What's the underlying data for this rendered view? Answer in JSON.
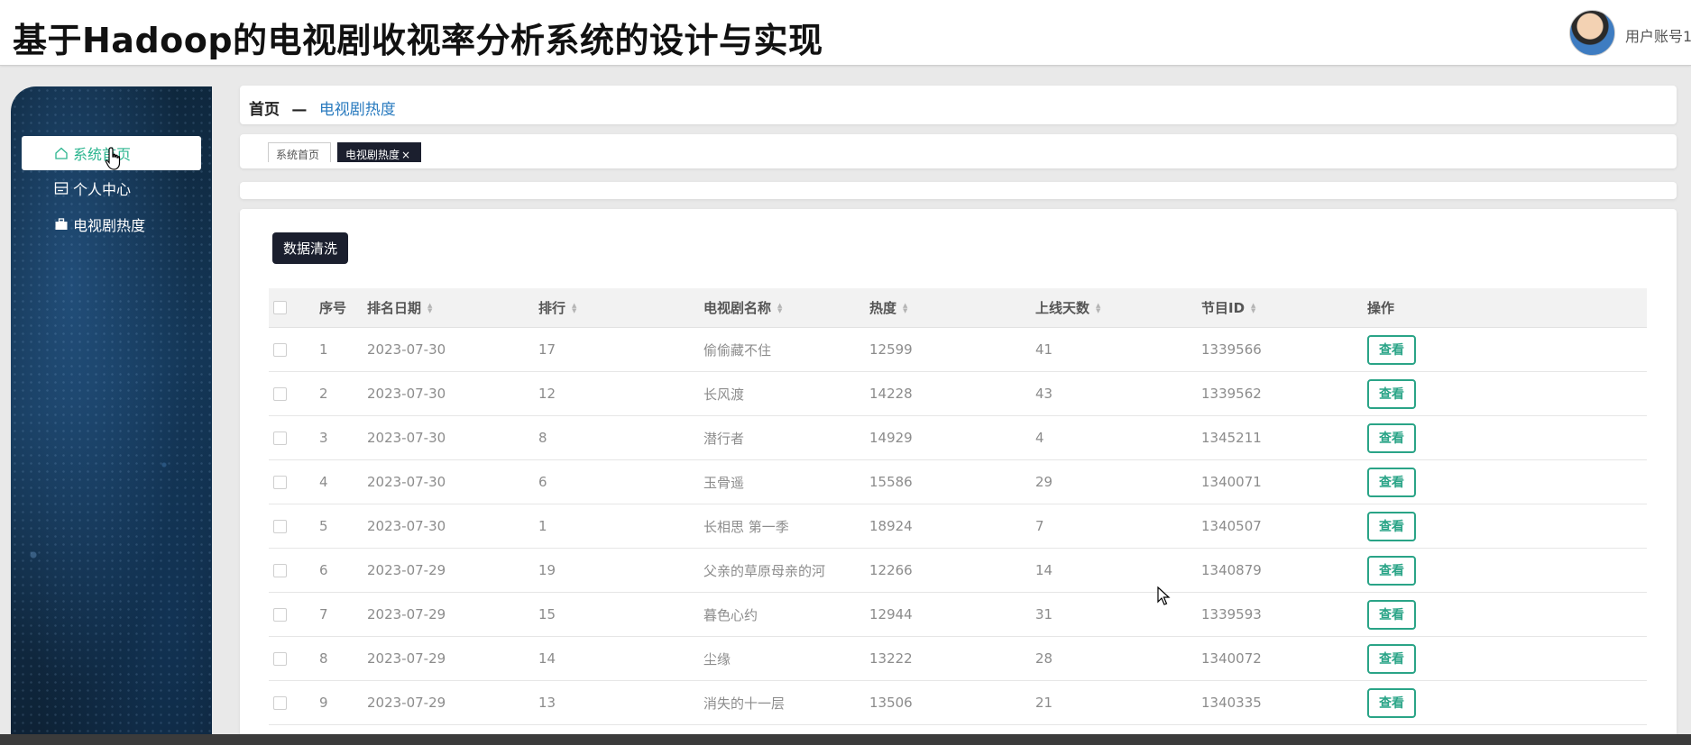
{
  "header": {
    "title": "基于Hadoop的电视剧收视率分析系统的设计与实现",
    "user_name": "用户账号1"
  },
  "sidebar": {
    "items": [
      {
        "label": "系统首页",
        "icon": "home-icon",
        "active": true
      },
      {
        "label": "个人中心",
        "icon": "profile-card-icon",
        "active": false
      },
      {
        "label": "电视剧热度",
        "icon": "briefcase-icon",
        "active": false
      }
    ]
  },
  "breadcrumb": {
    "home": "首页",
    "separator": "—",
    "current": "电视剧热度"
  },
  "tabs": {
    "home": "系统首页",
    "active": "电视剧热度",
    "close": "×"
  },
  "toolbar": {
    "clean_label": "数据清洗"
  },
  "table": {
    "headers": {
      "index": "序号",
      "date": "排名日期",
      "rank": "排行",
      "name": "电视剧名称",
      "heat": "热度",
      "days": "上线天数",
      "program_id": "节目ID",
      "action": "操作"
    },
    "view_label": "查看",
    "rows": [
      {
        "index": "1",
        "date": "2023-07-30",
        "rank": "17",
        "name": "偷偷藏不住",
        "heat": "12599",
        "days": "41",
        "program_id": "1339566"
      },
      {
        "index": "2",
        "date": "2023-07-30",
        "rank": "12",
        "name": "长风渡",
        "heat": "14228",
        "days": "43",
        "program_id": "1339562"
      },
      {
        "index": "3",
        "date": "2023-07-30",
        "rank": "8",
        "name": "潜行者",
        "heat": "14929",
        "days": "4",
        "program_id": "1345211"
      },
      {
        "index": "4",
        "date": "2023-07-30",
        "rank": "6",
        "name": "玉骨遥",
        "heat": "15586",
        "days": "29",
        "program_id": "1340071"
      },
      {
        "index": "5",
        "date": "2023-07-30",
        "rank": "1",
        "name": "长相思 第一季",
        "heat": "18924",
        "days": "7",
        "program_id": "1340507"
      },
      {
        "index": "6",
        "date": "2023-07-29",
        "rank": "19",
        "name": "父亲的草原母亲的河",
        "heat": "12266",
        "days": "14",
        "program_id": "1340879"
      },
      {
        "index": "7",
        "date": "2023-07-29",
        "rank": "15",
        "name": "暮色心约",
        "heat": "12944",
        "days": "31",
        "program_id": "1339593"
      },
      {
        "index": "8",
        "date": "2023-07-29",
        "rank": "14",
        "name": "尘缘",
        "heat": "13222",
        "days": "28",
        "program_id": "1340072"
      },
      {
        "index": "9",
        "date": "2023-07-29",
        "rank": "13",
        "name": "消失的十一层",
        "heat": "13506",
        "days": "21",
        "program_id": "1340335"
      }
    ]
  },
  "colors": {
    "accent": "#2bb58f",
    "dark_button": "#1b1f2e",
    "link": "#2a7bbf"
  }
}
